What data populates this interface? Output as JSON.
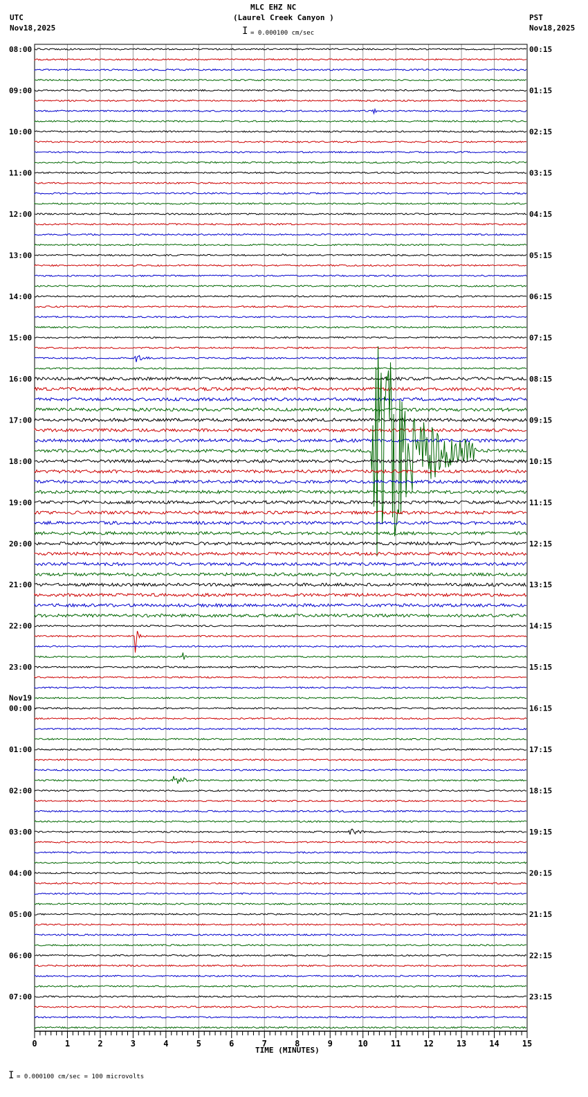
{
  "header": {
    "station": "MLC EHZ NC",
    "location": "(Laurel Creek Canyon )",
    "scale": "= 0.000100 cm/sec",
    "left_tz": "UTC",
    "left_date": "Nov18,2025",
    "right_tz": "PST",
    "right_date": "Nov18,2025"
  },
  "footer": {
    "scale_note": "= 0.000100 cm/sec =     100 microvolts"
  },
  "chart_data": {
    "type": "line",
    "title": "MLC EHZ NC (Laurel Creek Canyon )",
    "xlabel": "TIME (MINUTES)",
    "xlim": [
      0,
      15
    ],
    "xticks": [
      "0",
      "1",
      "2",
      "3",
      "4",
      "5",
      "6",
      "7",
      "8",
      "9",
      "10",
      "11",
      "12",
      "13",
      "14",
      "15"
    ],
    "traces_per_hour": 4,
    "trace_colors": [
      "#000000",
      "#cc0000",
      "#0000cc",
      "#006600"
    ],
    "left_labels": [
      "08:00",
      "09:00",
      "10:00",
      "11:00",
      "12:00",
      "13:00",
      "14:00",
      "15:00",
      "16:00",
      "17:00",
      "18:00",
      "19:00",
      "20:00",
      "21:00",
      "22:00",
      "23:00",
      "00:00",
      "01:00",
      "02:00",
      "03:00",
      "04:00",
      "05:00",
      "06:00",
      "07:00"
    ],
    "date_change_label": "Nov19",
    "right_labels": [
      "00:15",
      "01:15",
      "02:15",
      "03:15",
      "04:15",
      "05:15",
      "06:15",
      "07:15",
      "08:15",
      "09:15",
      "10:15",
      "11:15",
      "12:15",
      "13:15",
      "14:15",
      "15:15",
      "16:15",
      "17:15",
      "18:15",
      "19:15",
      "20:15",
      "21:15",
      "22:15",
      "23:15"
    ],
    "events": [
      {
        "trace": 6,
        "minute": 10.3,
        "duration": 0.2,
        "amplitude": 8
      },
      {
        "trace": 20,
        "minute": 7.5,
        "duration": 0.15,
        "amplitude": 3
      },
      {
        "trace": 30,
        "minute": 3.05,
        "duration": 0.5,
        "amplitude": 9
      },
      {
        "trace": 39,
        "minute": 10.25,
        "duration": 3.2,
        "amplitude": 240
      },
      {
        "trace": 57,
        "minute": 3.05,
        "duration": 0.25,
        "amplitude": 30
      },
      {
        "trace": 59,
        "minute": 4.5,
        "duration": 0.4,
        "amplitude": 7
      },
      {
        "trace": 71,
        "minute": 4.2,
        "duration": 1.0,
        "amplitude": 9
      },
      {
        "trace": 74,
        "minute": 9.0,
        "duration": 1.5,
        "amplitude": 2
      },
      {
        "trace": 76,
        "minute": 9.55,
        "duration": 0.9,
        "amplitude": 7
      },
      {
        "trace": 85,
        "minute": 12.7,
        "duration": 0.3,
        "amplitude": 5
      }
    ]
  }
}
